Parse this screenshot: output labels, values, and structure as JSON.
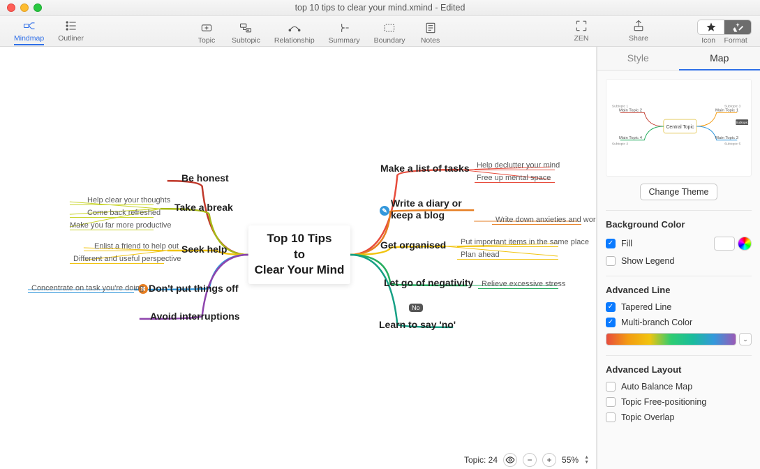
{
  "window": {
    "title": "top 10 tips to clear your mind.xmind - Edited"
  },
  "toolbar": {
    "mindmap": "Mindmap",
    "outliner": "Outliner",
    "topic": "Topic",
    "subtopic": "Subtopic",
    "relationship": "Relationship",
    "summary": "Summary",
    "boundary": "Boundary",
    "notes": "Notes",
    "zen": "ZEN",
    "share": "Share",
    "icon": "Icon",
    "format": "Format"
  },
  "sidebar": {
    "tabs": {
      "style": "Style",
      "map": "Map"
    },
    "change_theme": "Change Theme",
    "bg_color": {
      "header": "Background Color",
      "fill": "Fill",
      "show_legend": "Show Legend"
    },
    "adv_line": {
      "header": "Advanced Line",
      "tapered": "Tapered Line",
      "multi": "Multi-branch Color"
    },
    "adv_layout": {
      "header": "Advanced Layout",
      "auto_balance": "Auto Balance Map",
      "free_pos": "Topic Free-positioning",
      "overlap": "Topic Overlap"
    }
  },
  "statusbar": {
    "topic_label": "Topic:",
    "topic_count": "24",
    "zoom": "55%"
  },
  "mindmap": {
    "central": "Top 10 Tips\nto\nClear Your Mind",
    "left_branches": [
      {
        "label": "Be honest",
        "subs": []
      },
      {
        "label": "Take a break",
        "subs": [
          "Help clear your thoughts",
          "Come back refreshed",
          "Make you far more productive"
        ]
      },
      {
        "label": "Seek help",
        "subs": [
          "Enlist a friend to help out",
          "Different and useful perspective"
        ]
      },
      {
        "label": "Don't put things off",
        "subs": [
          "Concentrate on task you're doing"
        ],
        "marker": "x",
        "marker_color": "#e67e22"
      },
      {
        "label": "Avoid interruptions",
        "subs": []
      }
    ],
    "right_branches": [
      {
        "label": "Make a list of tasks",
        "subs": [
          "Help declutter your mind",
          "Free up mental space"
        ]
      },
      {
        "label": "Write a diary or keep a blog",
        "subs": [
          "Write down anxieties and worries"
        ],
        "marker": "✎",
        "marker_color": "#3498db"
      },
      {
        "label": "Get organised",
        "subs": [
          "Put important items in the same place",
          "Plan ahead"
        ]
      },
      {
        "label": "Let go of negativity",
        "subs": [
          "Relieve excessive stress"
        ]
      },
      {
        "label": "Learn to say 'no'",
        "subs": [],
        "badge": "No"
      }
    ]
  },
  "preview": {
    "central": "Central Topic",
    "main": [
      "Main Topic 1",
      "Main Topic 2",
      "Main Topic 3",
      "Main Topic 4"
    ],
    "sub": [
      "Subtopic 1",
      "Subtopic 2",
      "Subtopic 3",
      "Subtopic 4",
      "Subtopic 5"
    ]
  }
}
